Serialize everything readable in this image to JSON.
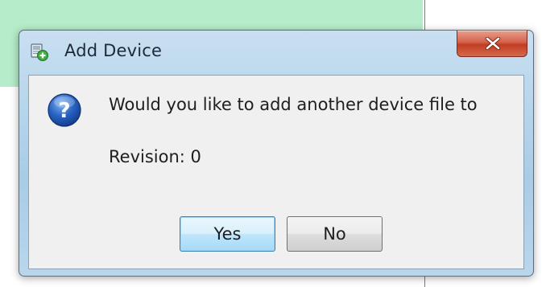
{
  "window": {
    "title": "Add Device",
    "title_icon": "add-device-icon",
    "close_icon": "close-icon"
  },
  "dialog": {
    "icon": "question-icon",
    "message": "Would you like to add another device file to",
    "revision": "Revision: 0"
  },
  "buttons": {
    "yes_label": "Yes",
    "no_label": "No",
    "default": "Yes"
  },
  "colors": {
    "titlebar": "#b5d4ea",
    "close_button": "#c13d22",
    "client_background": "#f0f0f0",
    "default_button_border": "#3c7fb1",
    "background_green": "#b6ecc9"
  }
}
